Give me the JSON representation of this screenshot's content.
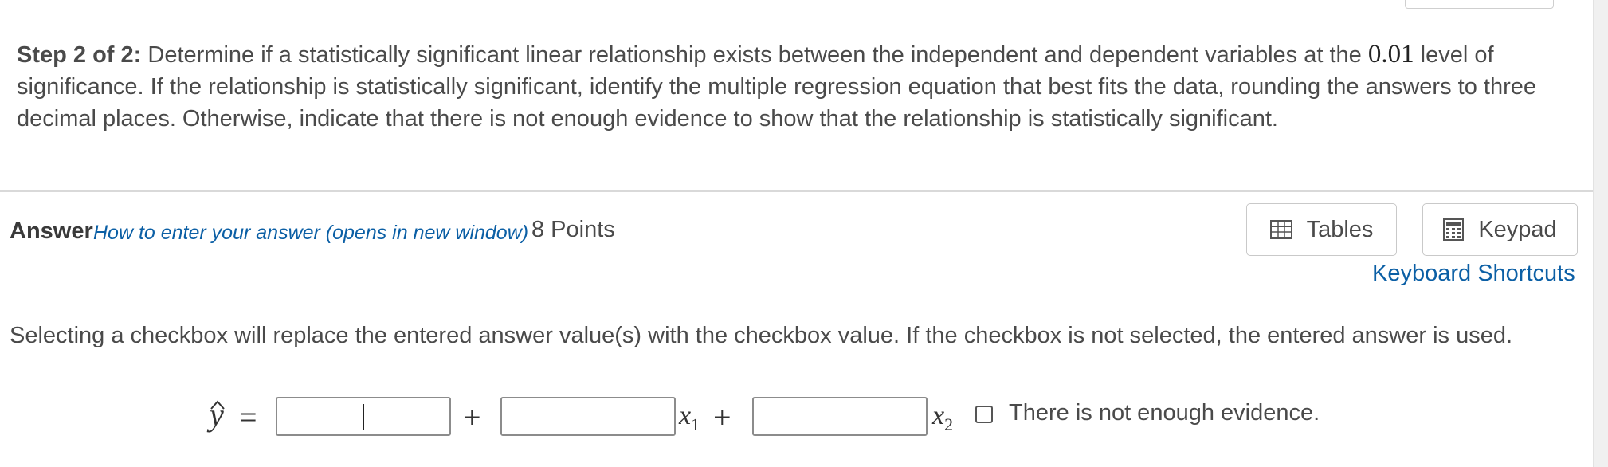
{
  "question": {
    "step_label": "Step 2 of 2:",
    "text_before_level": " Determine if a statistically significant linear relationship exists between the independent and dependent variables at the ",
    "significance_level": "0.01",
    "text_after_level": " level of significance. If the relationship is statistically significant, identify the multiple regression equation that best fits the data, rounding the answers to three decimal places. Otherwise, indicate that there is not enough evidence to show that the relationship is statistically significant."
  },
  "answer": {
    "label": "Answer",
    "howto_link": "How to enter your answer (opens in new window)",
    "points": "8 Points"
  },
  "toolbar": {
    "tables_label": "Tables",
    "keypad_label": "Keypad",
    "keyboard_shortcuts": "Keyboard Shortcuts"
  },
  "instruction": "Selecting a checkbox will replace the entered answer value(s) with the checkbox value. If the checkbox is not selected, the entered answer is used.",
  "equation": {
    "lhs": "y",
    "equals": "=",
    "plus": "+",
    "var1": "x",
    "var1_sub": "1",
    "var2": "x",
    "var2_sub": "2",
    "inputs": [
      "",
      "",
      ""
    ]
  },
  "checkbox": {
    "label": "There is not enough evidence.",
    "checked": false
  },
  "icons": {
    "tables": "table-grid-icon",
    "keypad": "calculator-keypad-icon"
  },
  "colors": {
    "link": "#0b5fa5",
    "text": "#4a4a4a",
    "divider": "#d9d9d9"
  }
}
